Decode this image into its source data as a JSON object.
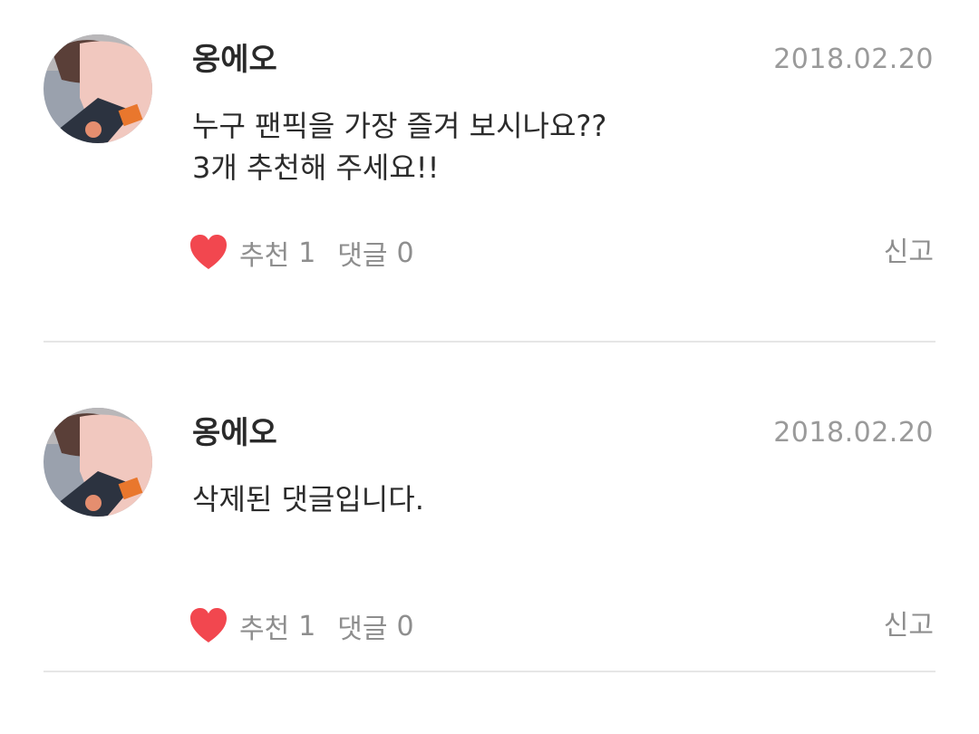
{
  "posts": [
    {
      "author": "옹에오",
      "date": "2018.02.20",
      "content": "누구 팬픽을 가장 즐겨 보시나요??\n3개 추천해 주세요!!",
      "like_label": "추천",
      "like_count": "1",
      "comment_label": "댓글",
      "comment_count": "0",
      "report_label": "신고"
    },
    {
      "author": "옹에오",
      "date": "2018.02.20",
      "content": "삭제된 댓글입니다.",
      "like_label": "추천",
      "like_count": "1",
      "comment_label": "댓글",
      "comment_count": "0",
      "report_label": "신고"
    }
  ],
  "colors": {
    "heart": "#f2474f",
    "meta_text": "#8e8e8e",
    "date_text": "#9a9a9a",
    "divider": "#e6e6e6"
  },
  "icons": {
    "like": "heart-icon",
    "avatar": "avatar"
  }
}
